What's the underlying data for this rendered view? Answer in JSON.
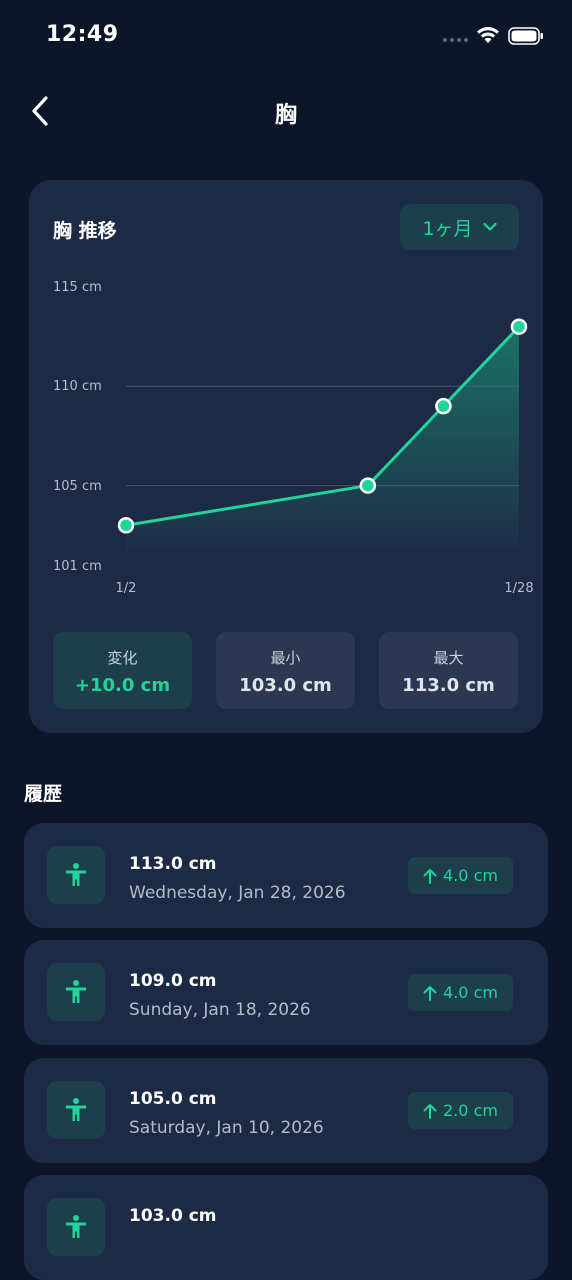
{
  "status_bar": {
    "time": "12:49"
  },
  "nav": {
    "title": "胸"
  },
  "chart_card": {
    "title": "胸 推移",
    "period": "1ヶ月",
    "stats": [
      {
        "label": "変化",
        "value": "+10.0 cm"
      },
      {
        "label": "最小",
        "value": "103.0 cm"
      },
      {
        "label": "最大",
        "value": "113.0 cm"
      }
    ]
  },
  "chart_data": {
    "type": "area",
    "x": [
      "1/2",
      "1/18",
      "1/23",
      "1/28"
    ],
    "x_tick_labels": [
      "1/2",
      "1/28"
    ],
    "y_tick_labels": [
      "115 cm",
      "110 cm",
      "105 cm",
      "101 cm"
    ],
    "series": [
      {
        "values": [
          103.0,
          105.0,
          109.0,
          113.0
        ]
      }
    ],
    "ylim": [
      101,
      115
    ],
    "grid": "horizontal at 105 and 110",
    "colors": {
      "line": "#1fd59a",
      "fill": "#1a8a72"
    }
  },
  "history": {
    "title": "履歴",
    "items": [
      {
        "value": "113.0 cm",
        "date": "Wednesday, Jan 28, 2026",
        "change": "4.0 cm",
        "icon": "body-icon"
      },
      {
        "value": "109.0 cm",
        "date": "Sunday, Jan 18, 2026",
        "change": "4.0 cm",
        "icon": "body-icon"
      },
      {
        "value": "105.0 cm",
        "date": "Saturday, Jan 10, 2026",
        "change": "2.0 cm",
        "icon": "body-icon"
      },
      {
        "value": "103.0 cm",
        "icon": "body-icon"
      }
    ]
  },
  "colors": {
    "background": "#0d1629",
    "card": "#1d2a45",
    "accent": "#1fd59a"
  }
}
